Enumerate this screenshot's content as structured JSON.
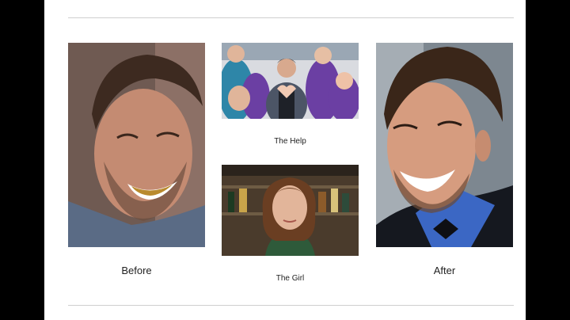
{
  "slide": {
    "before": {
      "caption": "Before",
      "image": "man-smiling-stained-teeth-photo"
    },
    "after": {
      "caption": "After",
      "image": "man-smiling-white-teeth-tuxedo-photo"
    },
    "help": {
      "caption": "The Help",
      "image": "group-heart-hands-photo"
    },
    "girl": {
      "caption": "The Girl",
      "image": "woman-in-bar-photo"
    }
  },
  "colors": {
    "background": "#000000",
    "slide": "#ffffff",
    "rule": "#cfcfcf",
    "text": "#222222"
  }
}
